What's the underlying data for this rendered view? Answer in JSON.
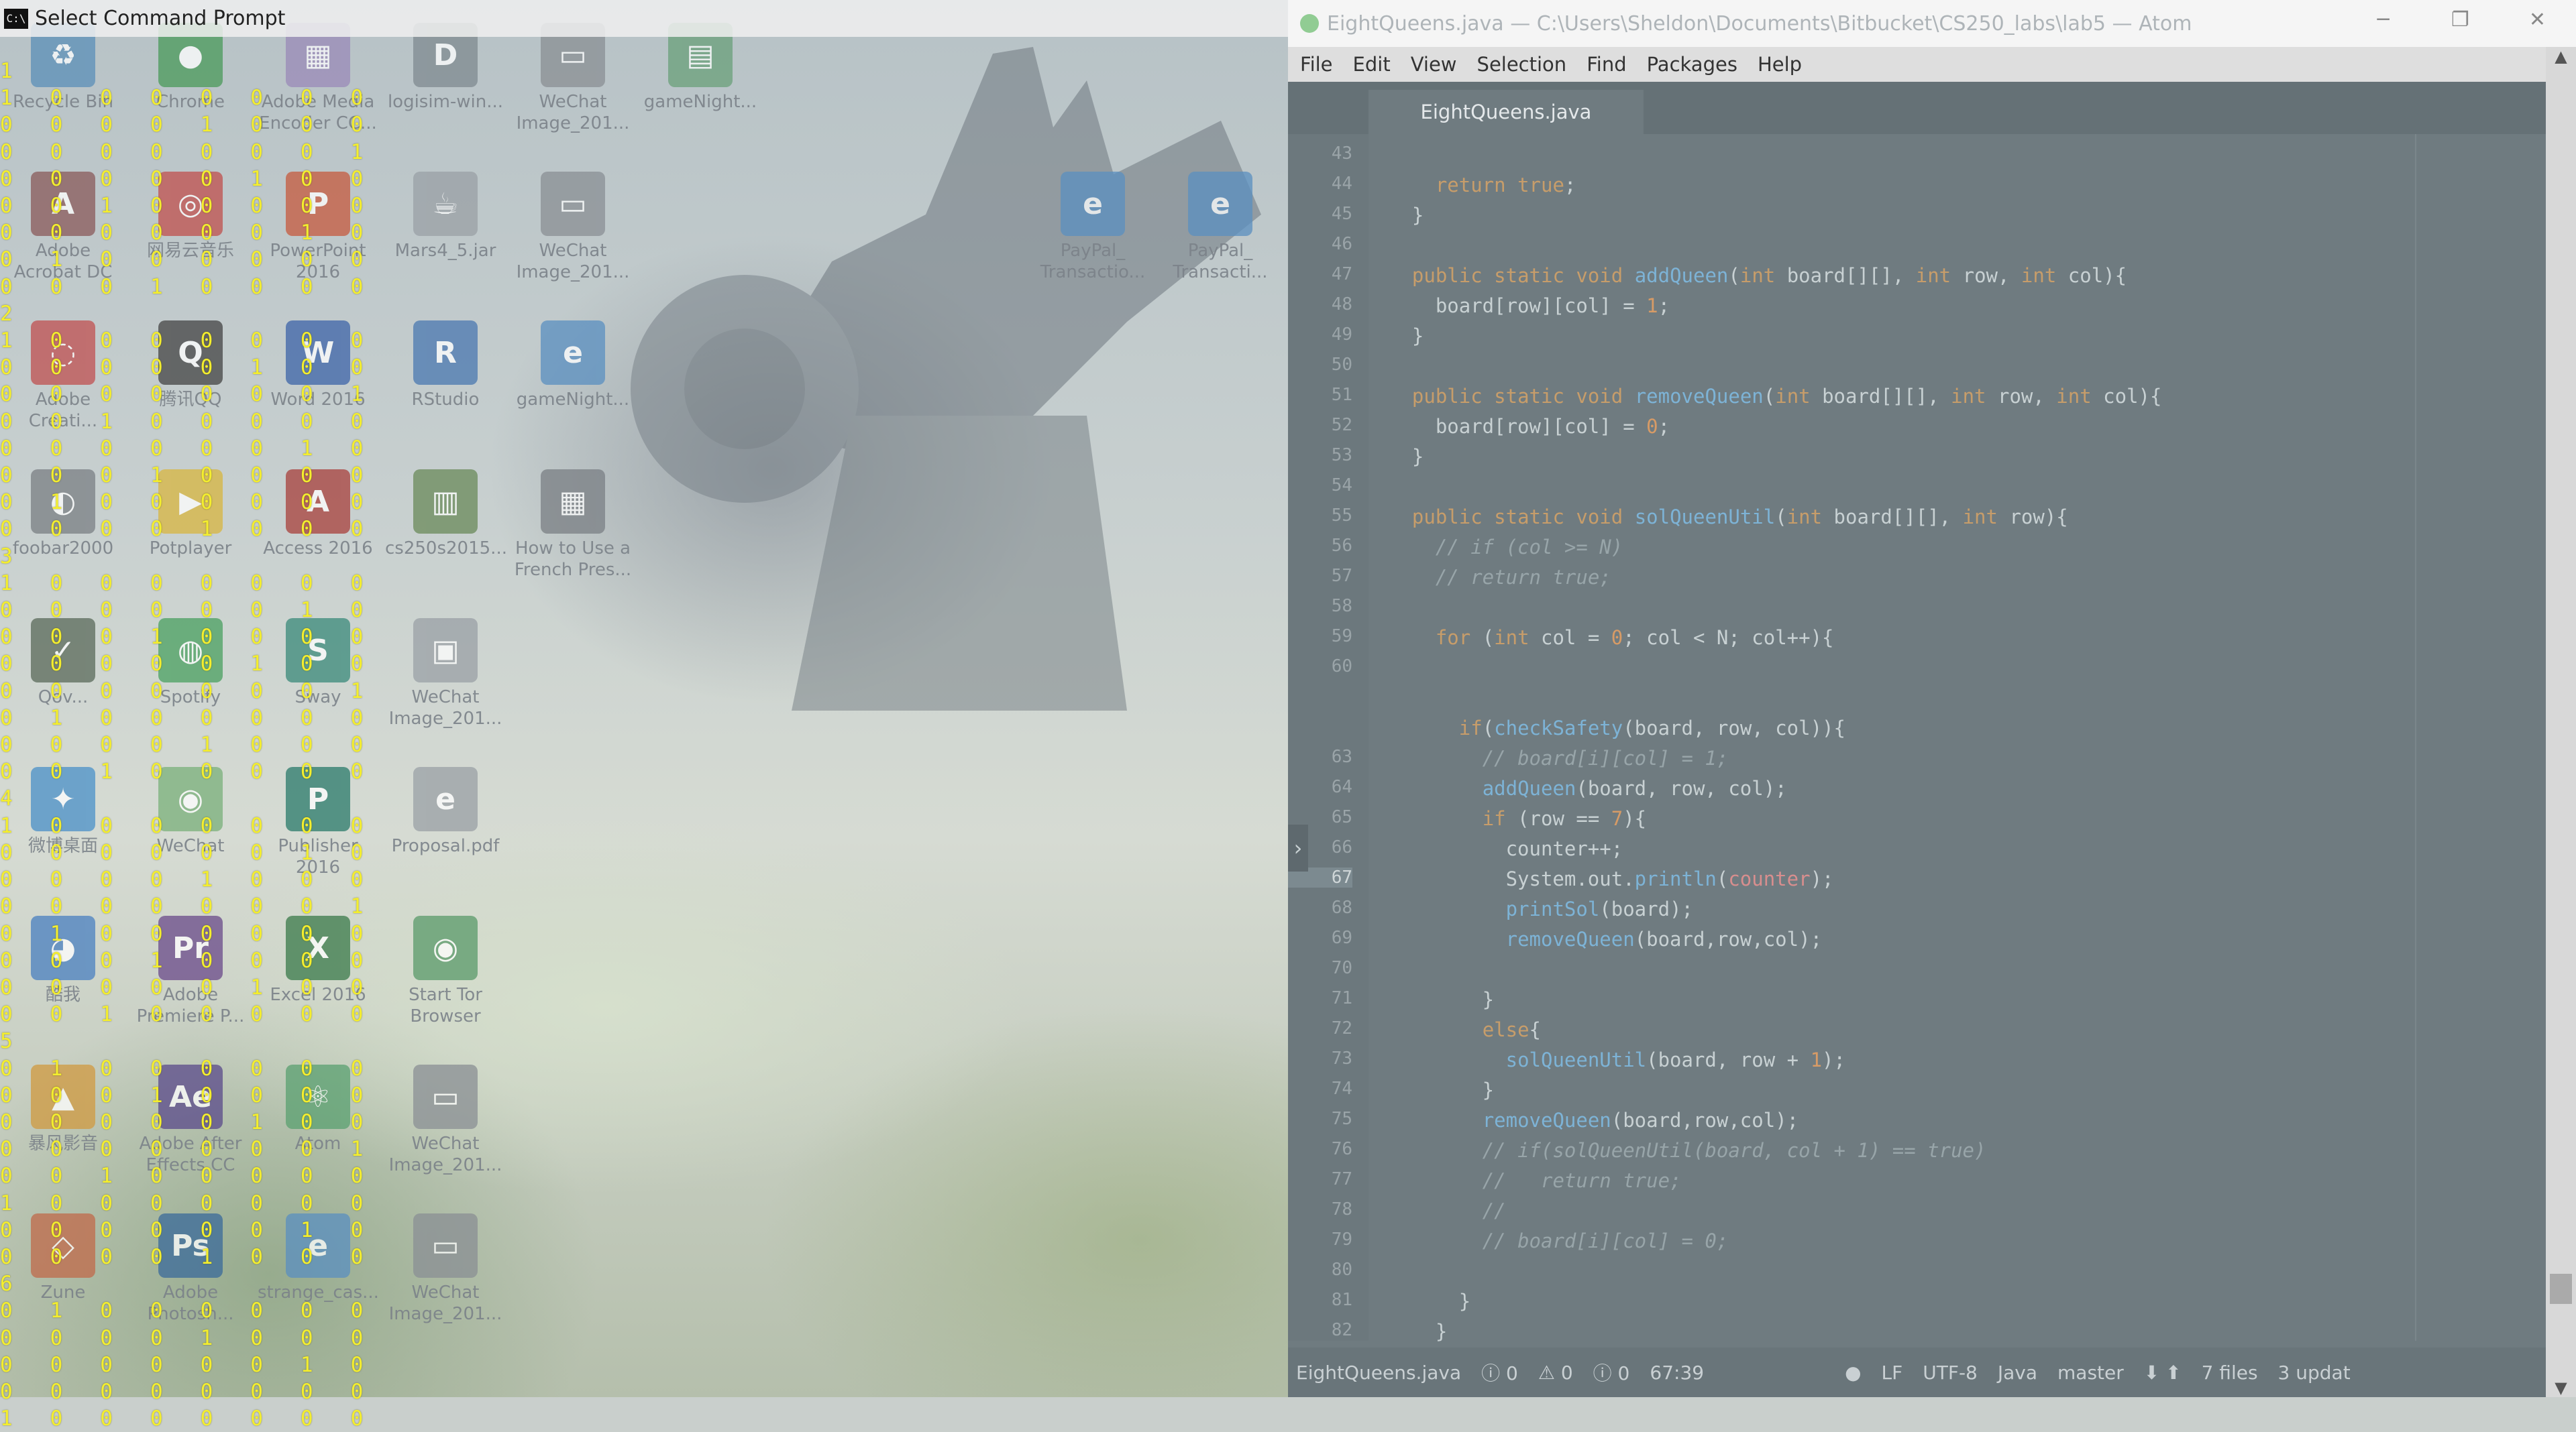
{
  "cmd_window": {
    "title": "Select Command Prompt",
    "icon": "C:\\"
  },
  "matrix_output": "1\n1   0   0   0   0   0   0   0\n0   0   0   0   1   0   0   0\n0   0   0   0   0   0   0   1\n0   0   0   0   0   1   0   0\n0   0   1   0   0   0   0   0\n0   0   0   0   0   0   1   0\n0   1   0   0   0   0   0   0\n0   0   0   1   0   0   0   0\n2\n1   0   0   0   0   0   0   0\n0   0   0   0   0   1   0   0\n0   0   0   0   0   0   0   1\n0   0   1   0   0   0   0   0\n0   0   0   0   0   0   1   0\n0   0   0   1   0   0   0   0\n0   1   0   0   0   0   0   0\n0   0   0   0   1   0   0   0\n3\n1   0   0   0   0   0   0   0\n0   0   0   0   0   0   1   0\n0   0   0   1   0   0   0   0\n0   0   0   0   0   1   0   0\n0   0   0   0   0   0   0   1\n0   1   0   0   0   0   0   0\n0   0   0   0   1   0   0   0\n0   0   1   0   0   0   0   0\n4\n1   0   0   0   0   0   0   0\n0   0   0   0   0   0   1   0\n0   0   0   0   1   0   0   0\n0   0   0   0   0   0   0   1\n0   1   0   0   0   0   0   0\n0   0   0   1   0   0   0   0\n0   0   0   0   0   1   0   0\n0   0   1   0   0   0   0   0\n5\n0   1   0   0   0   0   0   0\n0   0   0   1   0   0   0   0\n0   0   0   0   0   1   0   0\n0   0   0   0   0   0   0   1\n0   0   1   0   0   0   0   0\n1   0   0   0   0   0   0   0\n0   0   0   0   0   0   1   0\n0   0   0   0   1   0   0   0\n6\n0   1   0   0   0   0   0   0\n0   0   0   0   1   0   0   0\n0   0   0   0   0   0   1   0\n0   0   0   0   0   0   0   0\n1   0   0   0   0   0   0   0",
  "desktop_icons": [
    {
      "id": "recycle",
      "label": "Recycle Bin",
      "glyph": "♻",
      "color": "#5b8fb8"
    },
    {
      "id": "chrome",
      "label": "Chrome",
      "glyph": "●",
      "color": "#4a9a5a"
    },
    {
      "id": "ame",
      "label": "Adobe Media\nEncoder CC...",
      "glyph": "▦",
      "color": "#9a8ab8"
    },
    {
      "id": "logisim",
      "label": "logisim-win...",
      "glyph": "D",
      "color": "#7f8a90"
    },
    {
      "id": "wechat1",
      "label": "WeChat\nImage_201...",
      "glyph": "▭",
      "color": "#8a8f94"
    },
    {
      "id": "gamenight1",
      "label": "gameNight...",
      "glyph": "▤",
      "color": "#6aa07a"
    },
    {
      "id": "acrobat",
      "label": "Adobe\nAcrobat DC",
      "glyph": "A",
      "color": "#8a5a5a"
    },
    {
      "id": "netease",
      "label": "网易云音乐",
      "glyph": "◎",
      "color": "#c0504d"
    },
    {
      "id": "powerpoint",
      "label": "PowerPoint\n2016",
      "glyph": "P",
      "color": "#c65a3e"
    },
    {
      "id": "mars",
      "label": "Mars4_5.jar",
      "glyph": "☕",
      "color": "#9aa0a5"
    },
    {
      "id": "wechat2",
      "label": "WeChat\nImage_201...",
      "glyph": "▭",
      "color": "#8a8f94"
    },
    {
      "id": "paypal1",
      "label": "PayPal_\nTransactio...",
      "glyph": "e",
      "color": "#5a8fc0"
    },
    {
      "id": "paypal2",
      "label": "PayPal_\nTransacti...",
      "glyph": "e",
      "color": "#5a8fc0"
    },
    {
      "id": "cc",
      "label": "Adobe\nCreati...",
      "glyph": "◌",
      "color": "#c05050"
    },
    {
      "id": "qq",
      "label": "腾讯QQ",
      "glyph": "Q",
      "color": "#444"
    },
    {
      "id": "word",
      "label": "Word 2016",
      "glyph": "W",
      "color": "#3d64a8"
    },
    {
      "id": "rstudio",
      "label": "RStudio",
      "glyph": "R",
      "color": "#4a78b0"
    },
    {
      "id": "gamenight2",
      "label": "gameNight...",
      "glyph": "e",
      "color": "#5a8fc0"
    },
    {
      "id": "foobar",
      "label": "foobar2000",
      "glyph": "◐",
      "color": "#7a7f84"
    },
    {
      "id": "potplayer",
      "label": "Potplayer",
      "glyph": "▶",
      "color": "#d8b640"
    },
    {
      "id": "access",
      "label": "Access 2016",
      "glyph": "A",
      "color": "#a8403c"
    },
    {
      "id": "cs250",
      "label": "cs250s2015...",
      "glyph": "▥",
      "color": "#6a8a5a"
    },
    {
      "id": "howto",
      "label": "How to Use a\nFrench Pres...",
      "glyph": "▦",
      "color": "#7a7f84"
    },
    {
      "id": "quiver",
      "label": "Qov...",
      "glyph": "✓",
      "color": "#5a6a5a"
    },
    {
      "id": "spotify",
      "label": "Spotify",
      "glyph": "◍",
      "color": "#4aa060"
    },
    {
      "id": "sway",
      "label": "Sway",
      "glyph": "S",
      "color": "#3a8a7a"
    },
    {
      "id": "wechat3",
      "label": "WeChat\nImage_201...",
      "glyph": "▣",
      "color": "#9aa0a5"
    },
    {
      "id": "weibo",
      "label": "微博桌面",
      "glyph": "✦",
      "color": "#4a90c8"
    },
    {
      "id": "wechat-app",
      "label": "WeChat",
      "glyph": "◉",
      "color": "#7ab07a"
    },
    {
      "id": "publisher",
      "label": "Publisher\n2016",
      "glyph": "P",
      "color": "#2a7a6a"
    },
    {
      "id": "proposal",
      "label": "Proposal.pdf",
      "glyph": "e",
      "color": "#9aa0a5"
    },
    {
      "id": "kugou",
      "label": "酷我",
      "glyph": "◕",
      "color": "#4a80c0"
    },
    {
      "id": "premiere",
      "label": "Adobe\nPremiere P...",
      "glyph": "Pr",
      "color": "#6a4a8a"
    },
    {
      "id": "excel",
      "label": "Excel 2016",
      "glyph": "X",
      "color": "#3a7a4a"
    },
    {
      "id": "tor",
      "label": "Start Tor\nBrowser",
      "glyph": "◉",
      "color": "#5a9a6a"
    },
    {
      "id": "baofeng",
      "label": "暴风影音",
      "glyph": "▲",
      "color": "#d09a40"
    },
    {
      "id": "aftereffects",
      "label": "Adobe After\nEffects CC",
      "glyph": "Ae",
      "color": "#5a4a8a"
    },
    {
      "id": "atom-app",
      "label": "Atom",
      "glyph": "⚛",
      "color": "#5aa070"
    },
    {
      "id": "wechat4",
      "label": "WeChat\nImage_201...",
      "glyph": "▭",
      "color": "#8a8f94"
    },
    {
      "id": "zune",
      "label": "Zune",
      "glyph": "◇",
      "color": "#c06a4a"
    },
    {
      "id": "photoshop",
      "label": "Adobe\nPhotosh...",
      "glyph": "Ps",
      "color": "#3a6a9a"
    },
    {
      "id": "strange",
      "label": "strange_cas...",
      "glyph": "e",
      "color": "#5a8fc0"
    },
    {
      "id": "wechat5",
      "label": "WeChat\nImage_201...",
      "glyph": "▭",
      "color": "#8a8f94"
    }
  ],
  "atom": {
    "title": "EightQueens.java — C:\\Users\\Sheldon\\Documents\\Bitbucket\\CS250_labs\\lab5 — Atom",
    "window_buttons": {
      "minimize": "─",
      "restore": "❐",
      "close": "✕"
    },
    "menu": [
      "File",
      "Edit",
      "View",
      "Selection",
      "Find",
      "Packages",
      "Help"
    ],
    "tab_label": "EightQueens.java",
    "fold_arrow": "›",
    "lines": [
      {
        "n": "43",
        "code": ""
      },
      {
        "n": "44",
        "code": "    return true;"
      },
      {
        "n": "45",
        "code": "  }"
      },
      {
        "n": "46",
        "code": ""
      },
      {
        "n": "47",
        "code": "  public static void addQueen(int board[][], int row, int col){"
      },
      {
        "n": "48",
        "code": "    board[row][col] = 1;"
      },
      {
        "n": "49",
        "code": "  }"
      },
      {
        "n": "50",
        "code": ""
      },
      {
        "n": "51",
        "code": "  public static void removeQueen(int board[][], int row, int col){"
      },
      {
        "n": "52",
        "code": "    board[row][col] = 0;"
      },
      {
        "n": "53",
        "code": "  }"
      },
      {
        "n": "54",
        "code": ""
      },
      {
        "n": "55",
        "code": "  public static void solQueenUtil(int board[][], int row){"
      },
      {
        "n": "56",
        "code": "    // if (col >= N)"
      },
      {
        "n": "57",
        "code": "    // return true;"
      },
      {
        "n": "58",
        "code": ""
      },
      {
        "n": "59",
        "code": "    for (int col = 0; col < N; col++){"
      },
      {
        "n": "60",
        "code": ""
      },
      {
        "n": "",
        "code": ""
      },
      {
        "n": "",
        "code": "      if(checkSafety(board, row, col)){"
      },
      {
        "n": "63",
        "code": "        // board[i][col] = 1;"
      },
      {
        "n": "64",
        "code": "        addQueen(board, row, col);"
      },
      {
        "n": "65",
        "code": "        if (row == 7){"
      },
      {
        "n": "66",
        "code": "          counter++;"
      },
      {
        "n": "67",
        "code": "          System.out.println(counter);",
        "current": true
      },
      {
        "n": "68",
        "code": "          printSol(board);"
      },
      {
        "n": "69",
        "code": "          removeQueen(board,row,col);"
      },
      {
        "n": "70",
        "code": ""
      },
      {
        "n": "71",
        "code": "        }"
      },
      {
        "n": "72",
        "code": "        else{"
      },
      {
        "n": "73",
        "code": "          solQueenUtil(board, row + 1);"
      },
      {
        "n": "74",
        "code": "        }"
      },
      {
        "n": "75",
        "code": "        removeQueen(board,row,col);"
      },
      {
        "n": "76",
        "code": "        // if(solQueenUtil(board, col + 1) == true)"
      },
      {
        "n": "77",
        "code": "        //   return true;"
      },
      {
        "n": "78",
        "code": "        //"
      },
      {
        "n": "79",
        "code": "        // board[i][col] = 0;"
      },
      {
        "n": "80",
        "code": ""
      },
      {
        "n": "81",
        "code": "      }"
      },
      {
        "n": "82",
        "code": "    }"
      }
    ],
    "status": {
      "file": "EightQueens.java",
      "errors": "ⓘ 0",
      "warnings": "⚠ 0",
      "infos": "ⓘ 0",
      "cursor": "67:39",
      "line_ending": "LF",
      "encoding": "UTF-8",
      "grammar": "Java",
      "branch": "master",
      "files": "7 files",
      "updates": "3 updat"
    }
  }
}
